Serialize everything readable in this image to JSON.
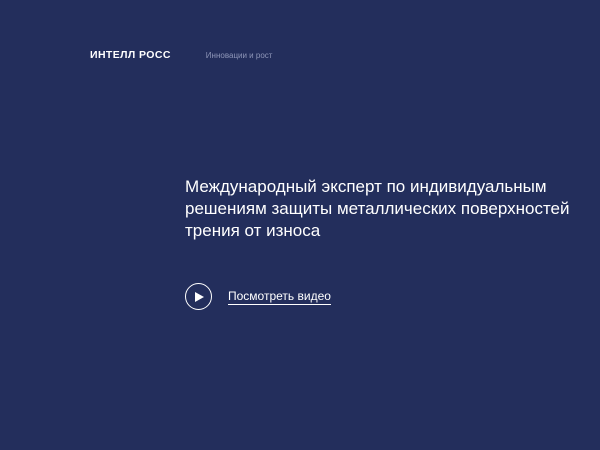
{
  "header": {
    "brand": "ИНТЕЛЛ РОСС",
    "tagline": "Инновации и рост"
  },
  "hero": {
    "headline_lines": [
      "Международный эксперт по индивидуальным",
      "решениям защиты металлических поверхностей",
      "трения от износа"
    ],
    "video_link_label": "Посмотреть видео",
    "video_icon": "play-icon"
  },
  "colors": {
    "background": "#232e5c",
    "text": "#ffffff",
    "tagline": "#8e96b8"
  }
}
